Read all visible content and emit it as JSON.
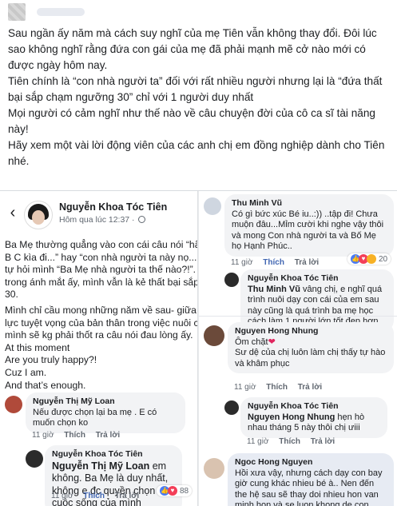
{
  "caption": {
    "lines": [
      "Sau ngần ấy năm mà cách suy nghĩ của mẹ Tiên vẫn không thay đổi. Đôi lúc sao không nghĩ rằng đứa con gái của mẹ đã phải mạnh mẽ cở nào mới có được ngày hôm nay.",
      "Tiên chính là “con nhà người ta” đối với rất nhiều người nhưng lại là “đứa thất bại sắp chạm ngưỡng 30” chỉ với 1 người duy nhất",
      "Mọi người có cảm nghĩ như thế nào về câu chuyện đời của cô ca sĩ tài năng này!",
      "Hãy xem một vài lời động viên của các anh chị em đồng nghiệp dành cho Tiên nhé."
    ]
  },
  "post": {
    "author": "Nguyễn Khoa Tóc Tiên",
    "time": "Hôm qua lúc 12:37 · ",
    "body": [
      "Ba Mẹ thường quẳng vào con cái câu nói “hã",
      "B C kìa đi...” hay “con nhà người ta này nọ...",
      "tự hỏi mình “Ba Mẹ nhà người ta thế nào?!”.",
      "trong ánh mắt ấy, mình vẫn là kẻ thất bại sắp",
      "30.",
      "Mình chỉ cầu mong những năm về sau- giữa",
      "lực tuyệt vọng của bản thân trong việc nuôi c",
      "mình sẽ kg phải thốt ra câu nói đau lòng ấy.",
      "At this moment",
      "Are you truly happy?!",
      "Cuz I am.",
      "And that’s enough."
    ]
  },
  "left_comments": [
    {
      "name": "Nguyễn Thị Mỹ Loan",
      "text": "Nếu được chọn lại ba mẹ . E có muốn chọn ko",
      "time": "11 giờ",
      "like": "Thích",
      "reply": "Trả lời",
      "reactions": ""
    },
    {
      "name": "Nguyễn Khoa Tóc Tiên",
      "tag": "Nguyễn Thị Mỹ Loan",
      "text": " em không. Ba Mẹ là duy nhất, không e đc quyền chọn cuộc sống của mình",
      "time": "11 giờ",
      "like": "Thích",
      "reply": "Trả lời",
      "reactions": "88"
    }
  ],
  "right_comments": [
    {
      "name": "Thu Minh Vũ",
      "text": "Có gì bức xúc Bé iu..:)) ..tập đi! Chưa muộn đâu...Mỉm cười khi nghe vậy thôi và mong Con nhà người ta và Bố Mẹ họ Hạnh Phúc..",
      "time": "11 giờ",
      "like": "Thích",
      "reply": "Trả lời",
      "reactions": "20"
    },
    {
      "name": "Nguyễn Khoa Tóc Tiên",
      "tag": "Thu Minh Vũ",
      "text": " vâng chị, e nghĩ quá trình nuôi dạy con cái của em sau này cũng là quá trình ba mẹ học cách làm 1 người lớn tốt đẹp hơn.",
      "time": "",
      "like": "",
      "reply": "",
      "reactions": ""
    },
    {
      "name": "Nguyen Hong Nhung",
      "text": "Ôm chặt",
      "text2": "Sư dệ của chị luôn làm chị thấy tự hào và khâm phục",
      "time": "11 giờ",
      "like": "Thích",
      "reply": "Trả lời",
      "reactions": ""
    },
    {
      "name": "Nguyễn Khoa Tóc Tiên",
      "tag": "Nguyen Hong Nhung",
      "text": " hẹn hò nhau tháng 5 này thôi chị ưiii",
      "time": "11 giờ",
      "like": "Thích",
      "reply": "Trả lời",
      "reactions": ""
    },
    {
      "name": "Ngoc Hong Nguyen",
      "text": "Hồi xưa vậy, nhưng cách dạy con bay giờ cung khác nhieu bé à.. Nen đến the hệ sau sẽ thay doi nhieu hon van minh hon và se luon khong de con minh tổn thương vì",
      "time": "",
      "like": "",
      "reply": "",
      "reactions": ""
    }
  ],
  "colors": {
    "accent": "#4267b2",
    "bubble": "#f2f3f5",
    "meta": "#606770",
    "heart": "#e0245e"
  }
}
